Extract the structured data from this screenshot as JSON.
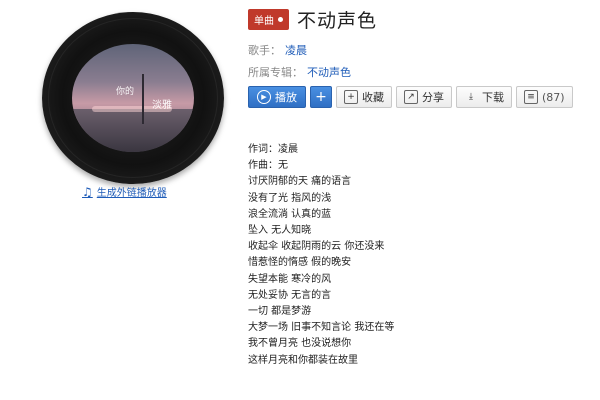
{
  "player_link": {
    "label": "生成外链播放器"
  },
  "cover": {
    "text1": "你的",
    "text2": "淡雅"
  },
  "badge": {
    "label": "单曲"
  },
  "song": {
    "title": "不动声色"
  },
  "meta": {
    "singer_label": "歌手：",
    "singer": "凌晨",
    "album_label": "所属专辑：",
    "album": "不动声色"
  },
  "actions": {
    "play": "播放",
    "add": "+",
    "collect": "收藏",
    "share": "分享",
    "download": "下载",
    "comments": "(87)"
  },
  "lyrics": [
    "作词：凌晨",
    "作曲：无",
    "讨厌阴郁的天 痛的语言",
    "没有了光 指风的浅",
    "浪全流淌 认真的蓝",
    "坠入 无人知晓",
    "收起伞 收起阴雨的云 你还没来",
    "惜惹怪的惰感 假的晚安",
    "失望本能 寒冷的风",
    "无处妥协 无言的言",
    "一切 都是梦游",
    "大梦一场 旧事不知言论 我还在等",
    "我不曾月亮 也没说想你",
    "这样月亮和你都装在故里"
  ],
  "colors": {
    "accent": "#2f6fc4",
    "badge": "#c0392b",
    "link": "#1f5cb8"
  }
}
